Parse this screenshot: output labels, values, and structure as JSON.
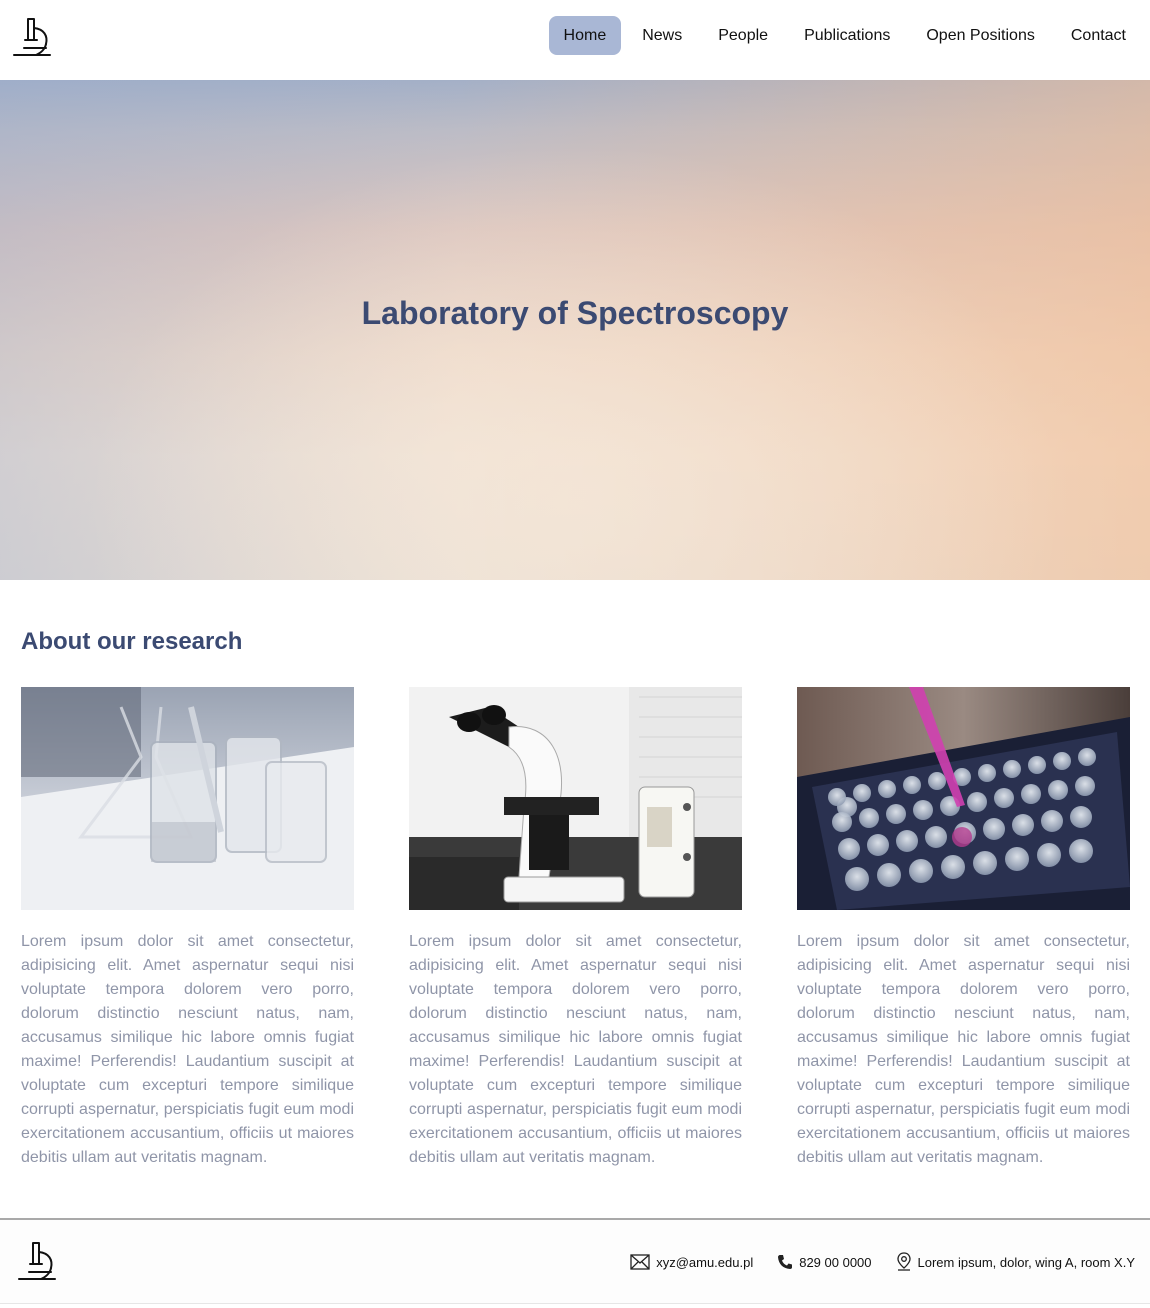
{
  "header": {
    "logo_icon": "microscope-icon",
    "nav": [
      {
        "label": "Home",
        "active": true
      },
      {
        "label": "News",
        "active": false
      },
      {
        "label": "People",
        "active": false
      },
      {
        "label": "Publications",
        "active": false
      },
      {
        "label": "Open Positions",
        "active": false
      },
      {
        "label": "Contact",
        "active": false
      }
    ],
    "active_color": "#a9b7d5"
  },
  "hero": {
    "title": "Laboratory of Spectroscopy",
    "title_color": "#3b4a72"
  },
  "about": {
    "title": "About our research",
    "cards": [
      {
        "image": "lab-glassware-photo",
        "text": "Lorem ipsum dolor sit amet consectetur, adipisicing elit. Amet aspernatur sequi nisi voluptate tempora dolorem vero porro, dolorum distinctio nesciunt natus, nam, accusamus similique hic labore omnis fugiat maxime! Perferendis! Laudantium suscipit at voluptate cum excepturi tempore similique corrupti aspernatur, perspiciatis fugit eum modi exercitationem accusantium, officiis ut maiores debitis ullam aut veritatis magnam."
      },
      {
        "image": "microscope-photo",
        "text": "Lorem ipsum dolor sit amet consectetur, adipisicing elit. Amet aspernatur sequi nisi voluptate tempora dolorem vero porro, dolorum distinctio nesciunt natus, nam, accusamus similique hic labore omnis fugiat maxime! Perferendis! Laudantium suscipit at voluptate cum excepturi tempore similique corrupti aspernatur, perspiciatis fugit eum modi exercitationem accusantium, officiis ut maiores debitis ullam aut veritatis magnam."
      },
      {
        "image": "pipette-tray-photo",
        "text": "Lorem ipsum dolor sit amet consectetur, adipisicing elit. Amet aspernatur sequi nisi voluptate tempora dolorem vero porro, dolorum distinctio nesciunt natus, nam, accusamus similique hic labore omnis fugiat maxime! Perferendis! Laudantium suscipit at voluptate cum excepturi tempore similique corrupti aspernatur, perspiciatis fugit eum modi exercitationem accusantium, officiis ut maiores debitis ullam aut veritatis magnam."
      }
    ]
  },
  "footer": {
    "logo_icon": "microscope-icon",
    "email": "xyz@amu.edu.pl",
    "email_icon": "envelope-icon",
    "phone": "829 00 0000",
    "phone_icon": "phone-icon",
    "address": "Lorem ipsum, dolor, wing A, room X.Y",
    "address_icon": "location-pin-icon"
  }
}
